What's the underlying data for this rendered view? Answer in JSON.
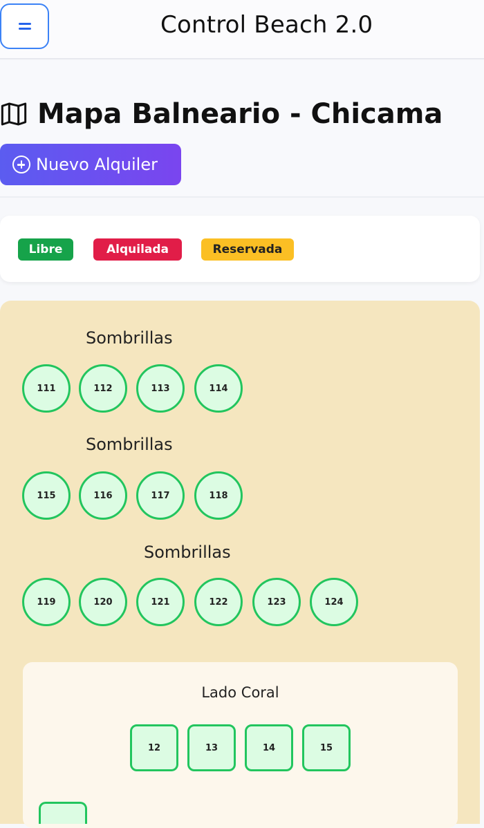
{
  "app": {
    "title": "Control Beach 2.0"
  },
  "page": {
    "title": "Mapa Balneario - Chicama",
    "new_rental_label": "Nuevo Alquiler"
  },
  "legend": [
    {
      "label": "Libre",
      "color": "#16a34a"
    },
    {
      "label": "Alquilada",
      "color": "#e11d48"
    },
    {
      "label": "Reservada",
      "color": "#fbbf24"
    }
  ],
  "zones": [
    {
      "label": "Sombrillas",
      "items": [
        "111",
        "112",
        "113",
        "114"
      ]
    },
    {
      "label": "Sombrillas",
      "items": [
        "115",
        "116",
        "117",
        "118"
      ]
    },
    {
      "label": "Sombrillas",
      "items": [
        "119",
        "120",
        "121",
        "122",
        "123",
        "124"
      ]
    }
  ],
  "coral": {
    "title": "Lado Coral",
    "items": [
      "12",
      "13",
      "14",
      "15"
    ]
  },
  "colors": {
    "free_fill": "#dcfce3",
    "free_border": "#22c55e",
    "beach_sand": "#f5e6bf",
    "accent": "#5b5cf0"
  },
  "icons": [
    "menu-icon",
    "map-icon",
    "plus-circle-icon"
  ]
}
